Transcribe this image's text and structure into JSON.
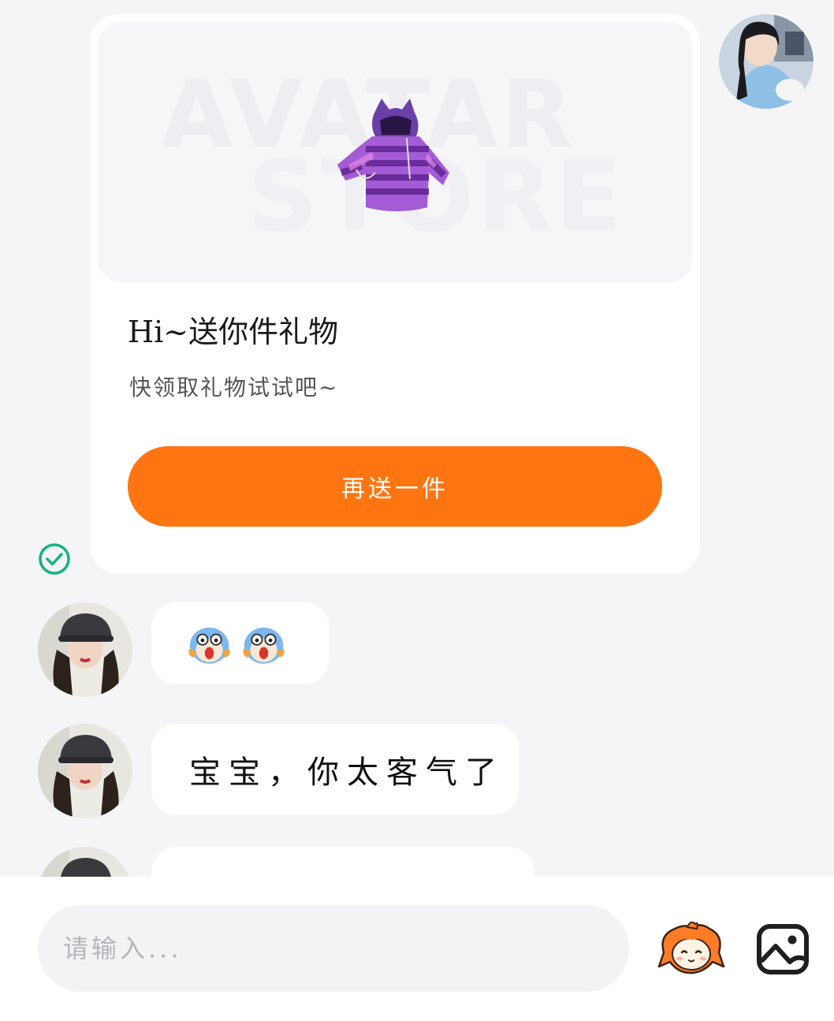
{
  "gift_card": {
    "banner_line_1": "AVATAR",
    "banner_line_2": "STORE",
    "title": "Hi~送你件礼物",
    "subtitle": "快领取礼物试试吧~",
    "button_label": "再送一件"
  },
  "messages": [
    {
      "type": "sticker",
      "stickers": [
        "shocked-face-sticker",
        "shocked-face-sticker"
      ]
    },
    {
      "type": "text",
      "text": "宝宝，你太客气了"
    },
    {
      "type": "text",
      "text": ""
    }
  ],
  "input": {
    "placeholder": "请输入..."
  },
  "colors": {
    "accent": "#ff7512",
    "sent_check": "#13b47c",
    "background": "#f5f5f7"
  },
  "icons": [
    "check-circle-icon",
    "mascot-emoji-icon",
    "image-icon"
  ]
}
